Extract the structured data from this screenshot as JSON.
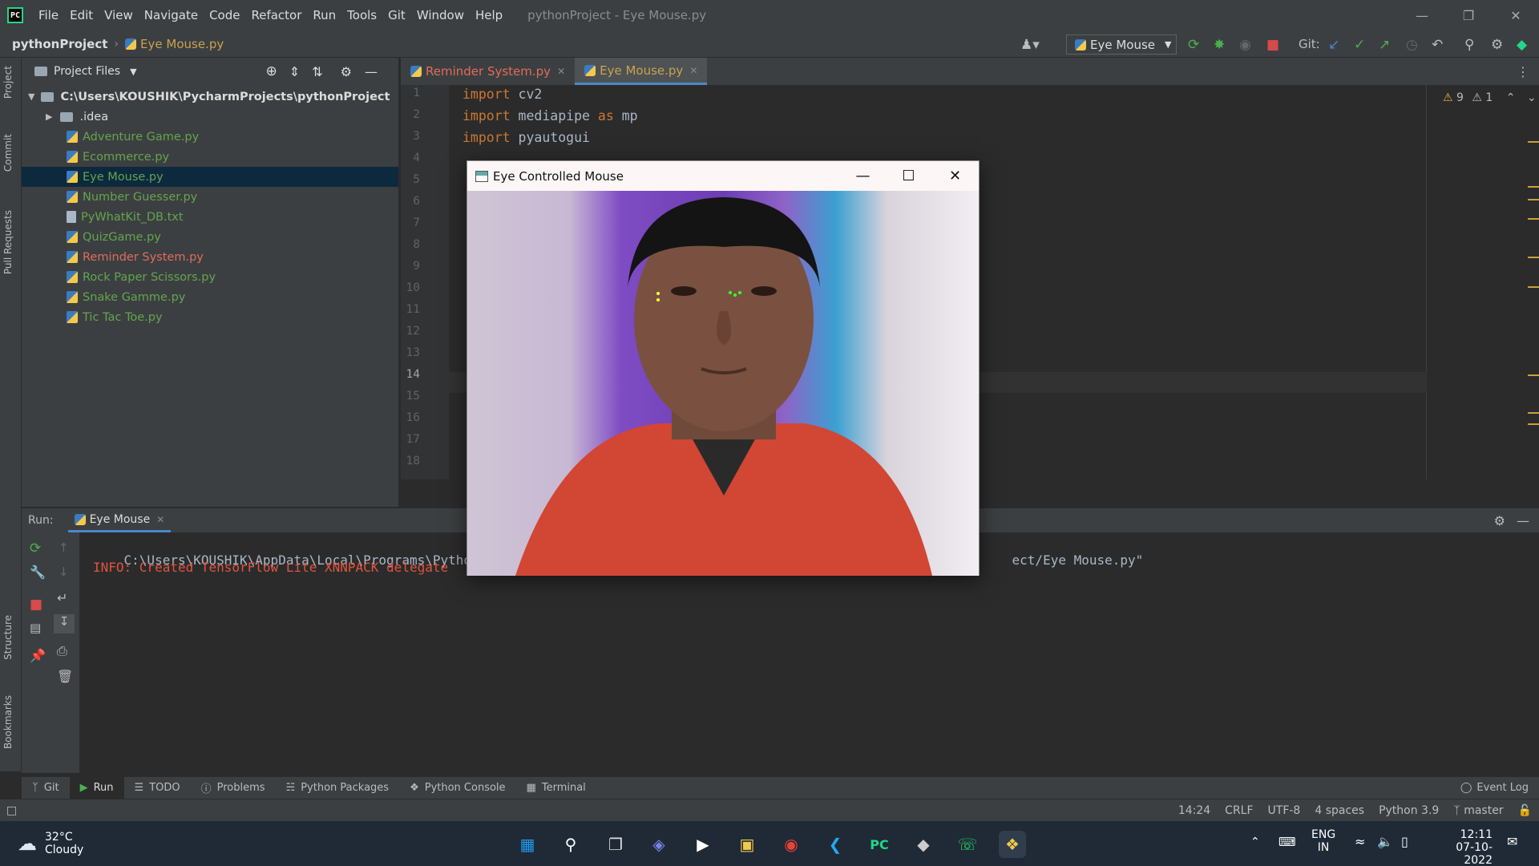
{
  "titlebar": {
    "menus": [
      "File",
      "Edit",
      "View",
      "Navigate",
      "Code",
      "Refactor",
      "Run",
      "Tools",
      "Git",
      "Window",
      "Help"
    ],
    "window_title": "pythonProject - Eye Mouse.py"
  },
  "navbar": {
    "project": "pythonProject",
    "file": "Eye Mouse.py",
    "run_config": "Eye Mouse",
    "git_label": "Git:"
  },
  "left_strip": {
    "project": "Project",
    "commit": "Commit",
    "pull_requests": "Pull Requests",
    "structure": "Structure",
    "bookmarks": "Bookmarks"
  },
  "project_panel": {
    "header": "Project Files",
    "root": "C:\\Users\\KOUSHIK\\PycharmProjects\\pythonProject",
    "idea": ".idea",
    "files": [
      {
        "name": "Adventure Game.py"
      },
      {
        "name": "Ecommerce.py"
      },
      {
        "name": "Eye Mouse.py"
      },
      {
        "name": "Number Guesser.py"
      },
      {
        "name": "PyWhatKit_DB.txt"
      },
      {
        "name": "QuizGame.py"
      },
      {
        "name": "Reminder System.py"
      },
      {
        "name": "Rock Paper Scissors.py"
      },
      {
        "name": "Snake Gamme.py"
      },
      {
        "name": "Tic Tac Toe.py"
      }
    ]
  },
  "editor": {
    "tabs": [
      {
        "label": "Reminder System.py"
      },
      {
        "label": "Eye Mouse.py"
      }
    ],
    "line_numbers": [
      "1",
      "2",
      "3",
      "4",
      "5",
      "6",
      "7",
      "8",
      "9",
      "10",
      "11",
      "12",
      "13",
      "14",
      "15",
      "16",
      "17",
      "18"
    ],
    "code": [
      {
        "kw": "import",
        "rest": " cv2"
      },
      {
        "kw": "import",
        "rest": " mediapipe ",
        "kw2": "as",
        "rest2": " mp"
      },
      {
        "kw": "import",
        "rest": " pyautogui"
      }
    ],
    "warnings": "9",
    "weak_warnings": "1"
  },
  "run": {
    "label": "Run:",
    "tab": "Eye Mouse",
    "line1_a": "C:\\Users\\KOUSHIK\\AppData\\Local\\Programs\\Python\\",
    "line1_b": "ect/Eye Mouse.py\"",
    "line2": "INFO: Created TensorFlow Lite XNNPACK delegate"
  },
  "bottom_tabs": [
    "Git",
    "Run",
    "TODO",
    "Problems",
    "Python Packages",
    "Python Console",
    "Terminal"
  ],
  "event_log": "Event Log",
  "status": {
    "position": "14:24",
    "line_sep": "CRLF",
    "encoding": "UTF-8",
    "indent": "4 spaces",
    "interpreter": "Python 3.9",
    "branch": "master"
  },
  "cv_window": {
    "title": "Eye Controlled Mouse"
  },
  "taskbar": {
    "weather_temp": "32°C",
    "weather_desc": "Cloudy",
    "lang1": "ENG",
    "lang2": "IN",
    "time": "12:11",
    "date": "07-10-2022"
  },
  "colors": {
    "accent_blue": "#4a88c7",
    "file_green": "#62a54c",
    "file_red": "#e06c5a",
    "keyword": "#cc7832"
  }
}
